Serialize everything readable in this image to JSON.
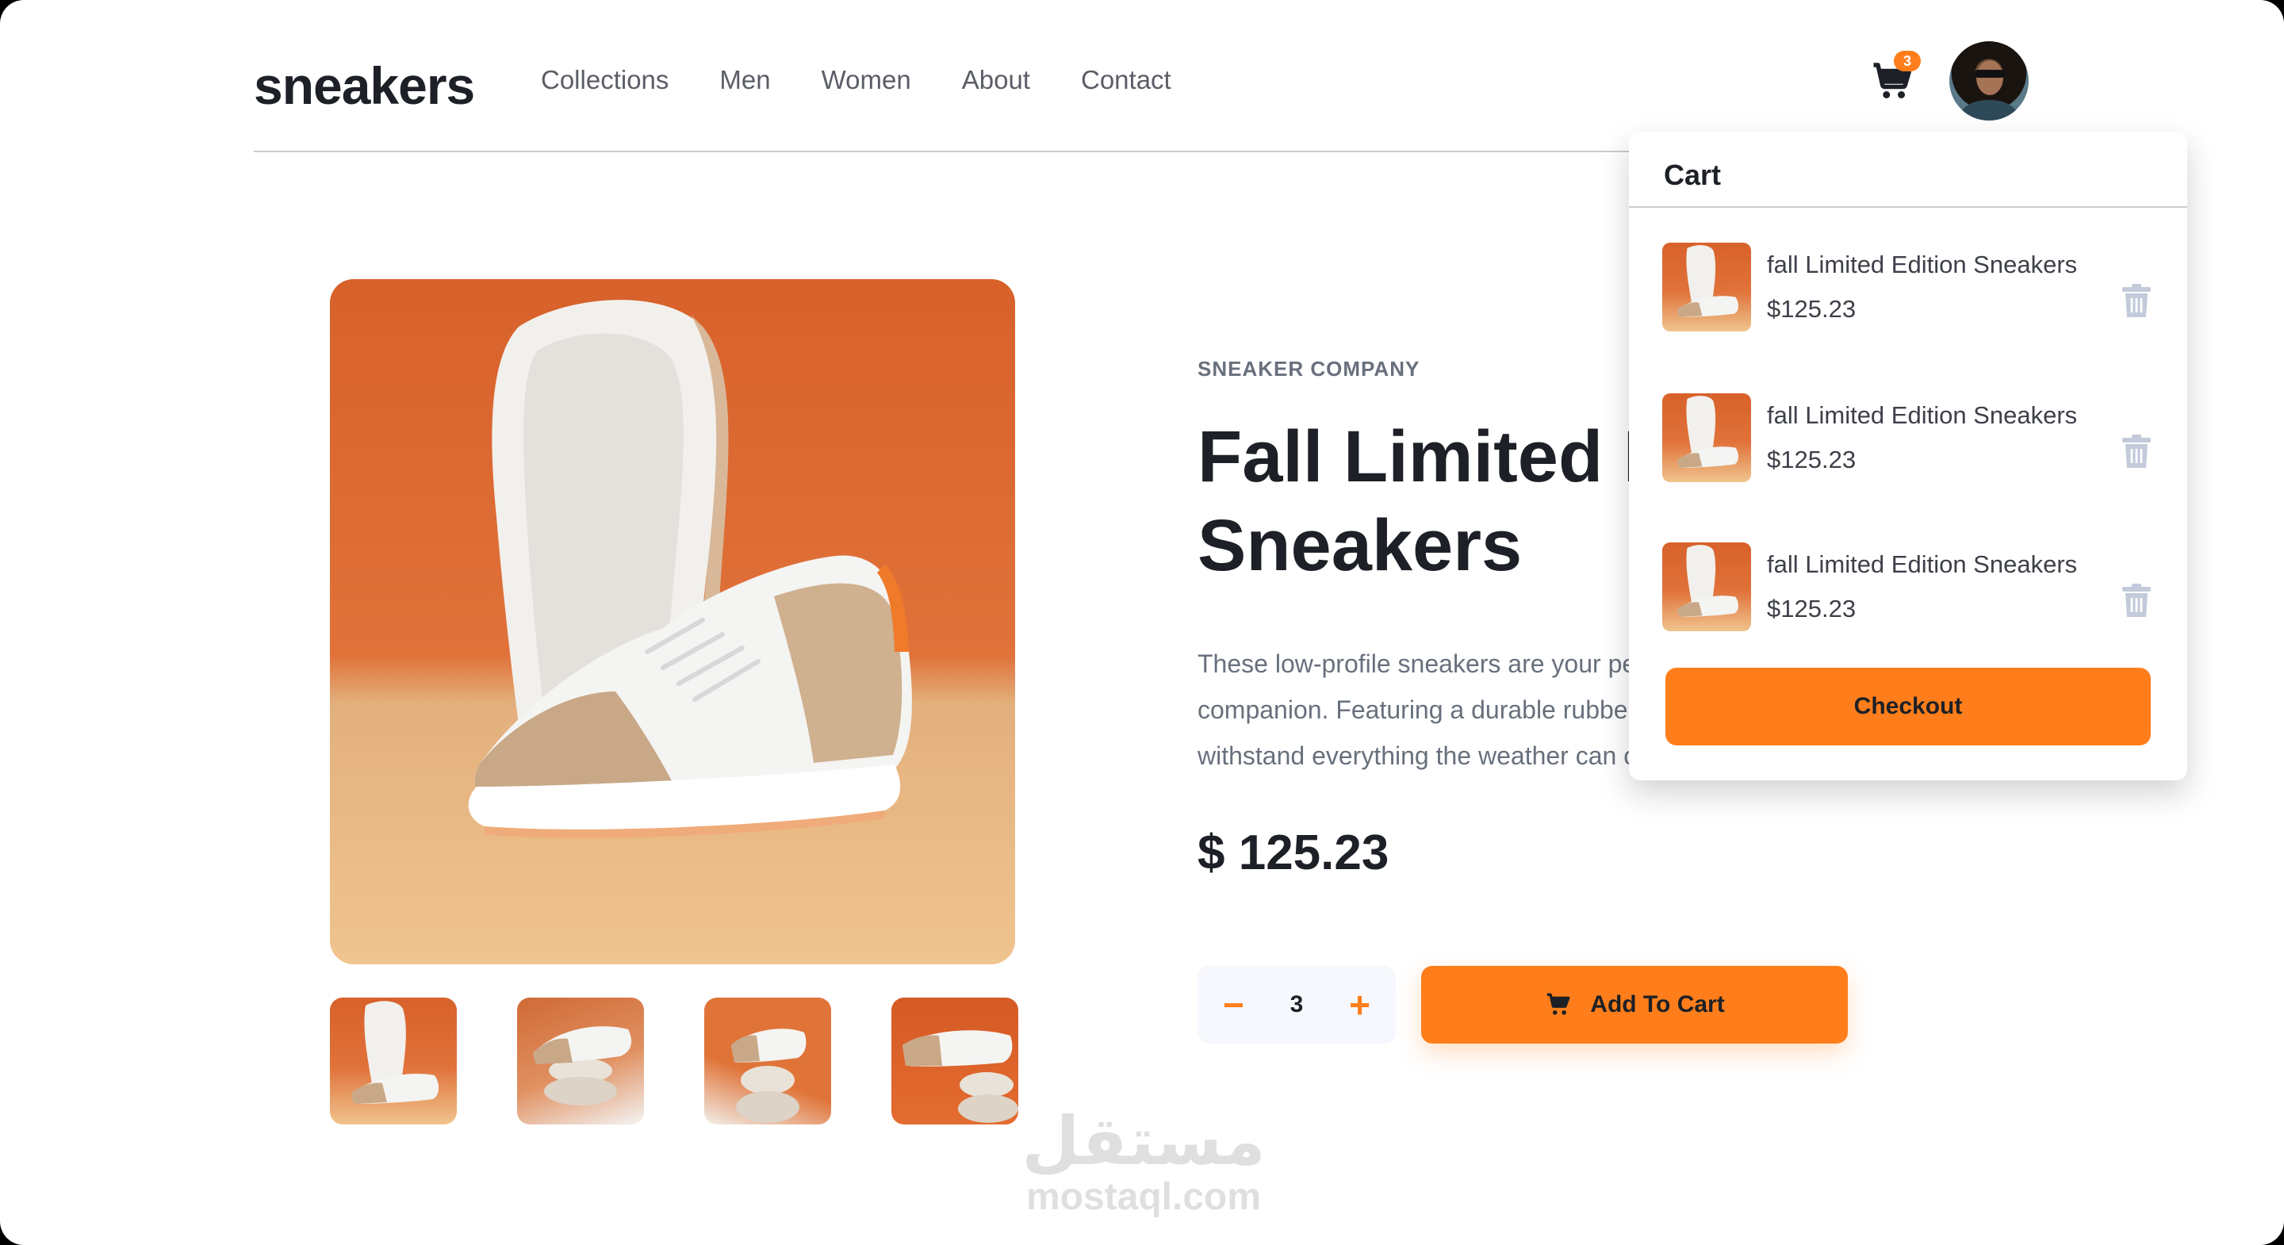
{
  "brand": {
    "logo": "sneakers",
    "accent": "#ff7e1b",
    "dark": "#1d2026"
  },
  "nav": {
    "items": [
      "Collections",
      "Men",
      "Women",
      "About",
      "Contact"
    ]
  },
  "header": {
    "cart_count": "3",
    "cart_icon": "cart-icon",
    "avatar": "user-avatar"
  },
  "product": {
    "company": "SNEAKER COMPANY",
    "title": "Fall Limited Edition Sneakers",
    "description": "These low-profile sneakers are your perfect casual wear companion. Featuring a durable rubber outer sole, they'll withstand everything the weather can offer.",
    "price": "$ 125.23",
    "quantity": "3",
    "minus_label": "−",
    "plus_label": "+",
    "add_to_cart_label": "Add To Cart"
  },
  "cart": {
    "title": "Cart",
    "items": [
      {
        "name": "fall Limited Edition Sneakers",
        "price": "$125.23"
      },
      {
        "name": "fall Limited Edition Sneakers",
        "price": "$125.23"
      },
      {
        "name": "fall Limited Edition Sneakers",
        "price": "$125.23"
      }
    ],
    "checkout_label": "Checkout"
  },
  "watermark": {
    "arabic": "مستقل",
    "latin": "mostaql.com"
  }
}
